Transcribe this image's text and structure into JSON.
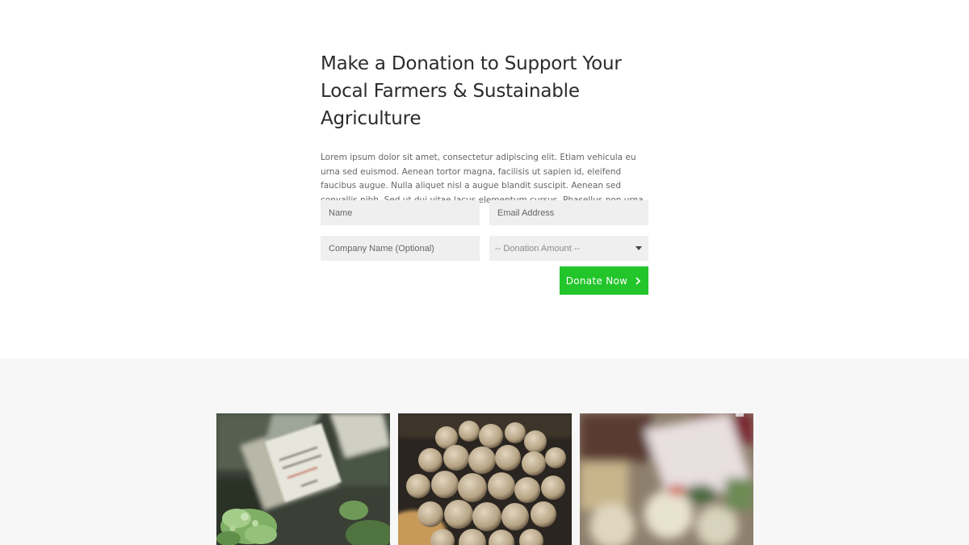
{
  "donation": {
    "headline": "Make a Donation to Support Your Local Farmers & Sustainable Agriculture",
    "intro": "Lorem ipsum dolor sit amet, consectetur adipiscing elit. Etiam vehicula eu urna sed euismod. Aenean tortor magna, facilisis ut sapien id, eleifend faucibus augue. Nulla aliquet nisl a augue blandit suscipit. Aenean sed convallis nibh. Sed ut dui vitae lacus elementum cursus. Phasellus non urna vel nunc iaculis porttitor.",
    "form": {
      "name_placeholder": "Name",
      "name_value": "",
      "email_placeholder": "Email Address",
      "email_value": "",
      "company_placeholder": "Company Name (Optional)",
      "company_value": "",
      "amount_selected": "-- Donation Amount --",
      "submit_label": "Donate Now"
    }
  },
  "gallery": {
    "images": [
      {
        "name": "kale-market-photo"
      },
      {
        "name": "sunchokes-photo"
      },
      {
        "name": "produce-stall-photo"
      }
    ]
  },
  "colors": {
    "accent": "#22c52a",
    "field_bg": "#efefef",
    "section_bg": "#f7f7f7"
  }
}
